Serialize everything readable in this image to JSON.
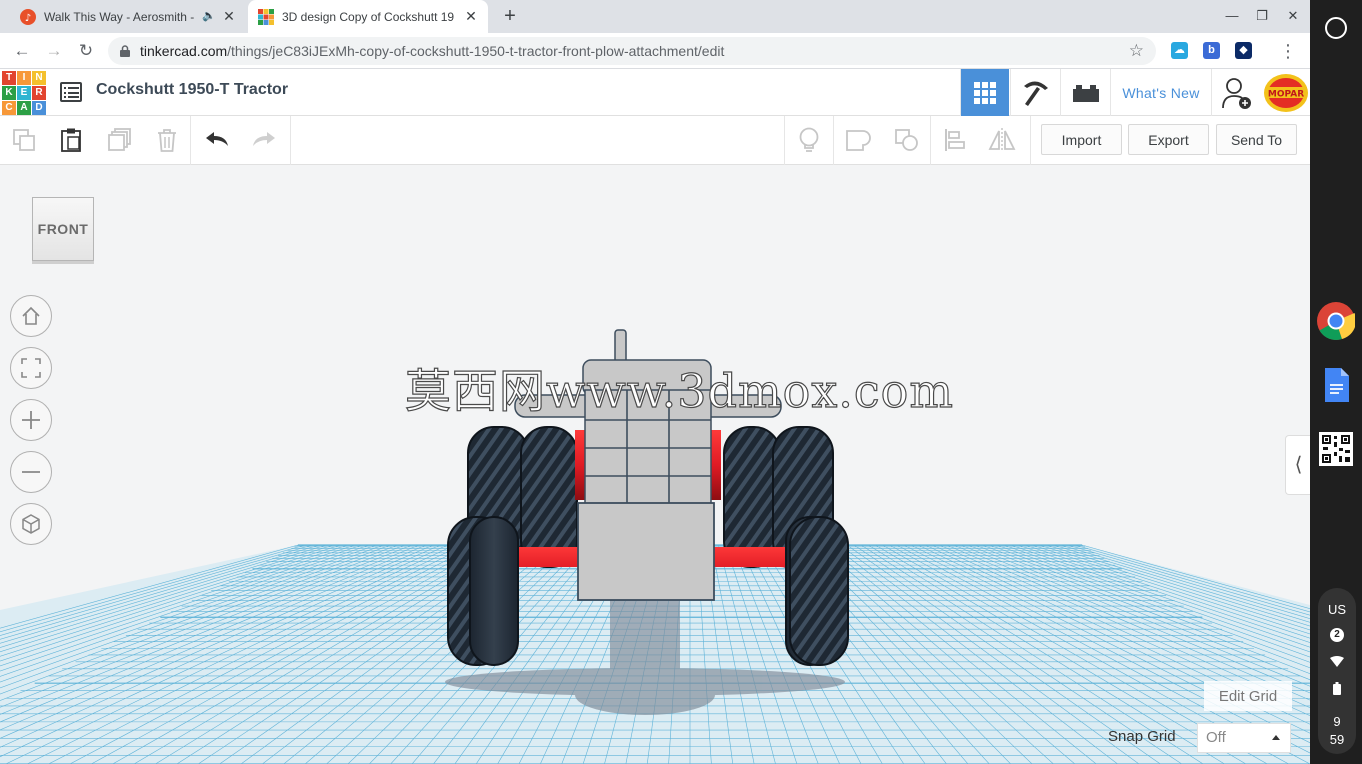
{
  "browser": {
    "tabs": [
      {
        "title": "Walk This Way - Aerosmith -",
        "favicon": "music-app-icon",
        "audio": true
      },
      {
        "title": "3D design Copy of Cockshutt 19",
        "favicon": "tinkercad-grid-icon",
        "active": true
      }
    ],
    "new_tab": "+",
    "url_domain": "tinkercad.com",
    "url_path": "/things/jeC83iJExMh-copy-of-cockshutt-1950-t-tractor-front-plow-attachment/edit",
    "extensions": [
      "cloud-extension-icon",
      "b-extension-icon",
      "dark-extension-icon"
    ]
  },
  "tinkercad": {
    "logo_letters": [
      "T",
      "I",
      "N",
      "K",
      "E",
      "R",
      "C",
      "A",
      "D"
    ],
    "logo_colors": [
      "#e2442f",
      "#f79838",
      "#f4c02d",
      "#2c9f45",
      "#2fb5d1",
      "#e2442f",
      "#f79838",
      "#2c9f45",
      "#4a90d9"
    ],
    "design_title": "Cockshutt 1950-T Tractor",
    "whats_new": "What's New",
    "avatar_text": "MOPAR",
    "toolbar": {
      "import": "Import",
      "export": "Export",
      "send_to": "Send To"
    },
    "viewcube_face": "FRONT",
    "edit_grid": "Edit Grid",
    "snap_grid_label": "Snap Grid",
    "snap_grid_value": "Off"
  },
  "watermark": "莫西网www.3dmox.com",
  "shelf": {
    "locale": "US",
    "notifications": "2",
    "time_hour": "9",
    "time_min": "59"
  },
  "colors": {
    "accent": "#4a90d9",
    "grid_line": "#5fb3d8",
    "tractor_red": "#e01b24",
    "tractor_gray": "#c8c8c8"
  }
}
